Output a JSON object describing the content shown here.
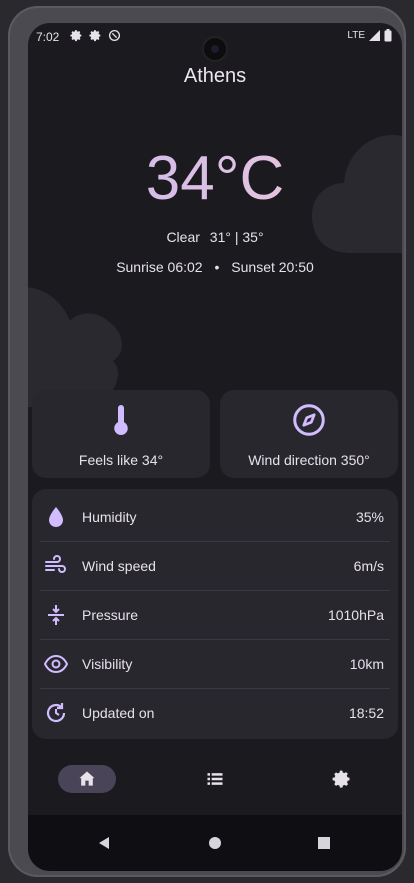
{
  "status_bar": {
    "time": "7:02",
    "network": "LTE"
  },
  "city": "Athens",
  "current": {
    "temperature": "34°C",
    "condition": "Clear",
    "range": "31° | 35°",
    "sunrise": "Sunrise 06:02",
    "separator": "•",
    "sunset": "Sunset 20:50"
  },
  "cards": {
    "feels_like": "Feels like 34°",
    "wind_direction": "Wind direction 350°"
  },
  "details": [
    {
      "label": "Humidity",
      "value": "35%",
      "icon": "humidity-icon"
    },
    {
      "label": "Wind speed",
      "value": "6m/s",
      "icon": "wind-icon"
    },
    {
      "label": "Pressure",
      "value": "1010hPa",
      "icon": "pressure-icon"
    },
    {
      "label": "Visibility",
      "value": "10km",
      "icon": "visibility-icon"
    },
    {
      "label": "Updated on",
      "value": "18:52",
      "icon": "update-icon"
    }
  ],
  "bottom_nav": [
    "home-icon",
    "list-icon",
    "settings-icon"
  ],
  "colors": {
    "background": "#1b1a1f",
    "card": "#29272e",
    "accent": "#d0bcff",
    "nav_active": "#4a4458"
  }
}
